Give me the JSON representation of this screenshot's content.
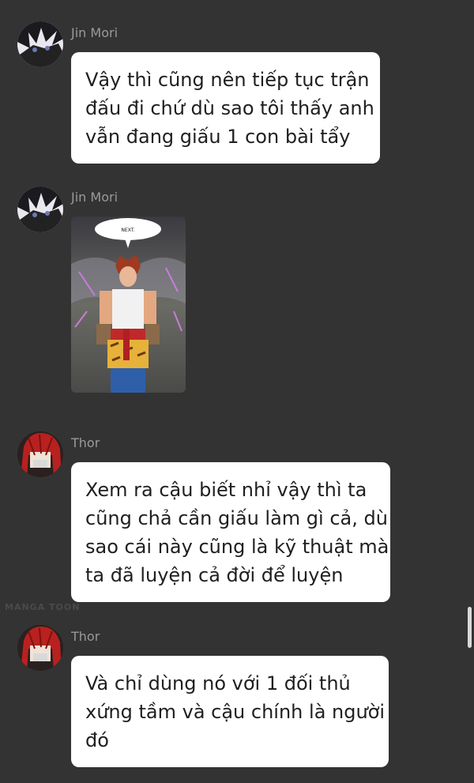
{
  "messages": [
    {
      "sender": "Jin Mori",
      "lines": [
        "Vậy thì cũng nên tiếp tục trận",
        "đấu đi chứ dù sao tôi thấy anh",
        "vẫn đang giấu 1 con bài tẩy"
      ]
    },
    {
      "sender": "Jin Mori",
      "image": {
        "speech_text": "NEXT."
      }
    },
    {
      "sender": "Thor",
      "lines": [
        "Xem ra cậu biết nhỉ vậy thì ta",
        "cũng chả cần giấu làm gì cả, dù",
        "sao cái này cũng là kỹ thuật mà",
        "ta đã luyện cả đời để luyện"
      ]
    },
    {
      "sender": "Thor",
      "lines": [
        "Và chỉ dùng nó với 1 đối thủ",
        "xứng tầm và cậu chính là người",
        "đó"
      ]
    }
  ],
  "watermark": "MANGA TOON",
  "colors": {
    "background": "#333333",
    "bubble": "#ffffff",
    "name": "#9a9a9a",
    "text": "#1f1f1f"
  }
}
